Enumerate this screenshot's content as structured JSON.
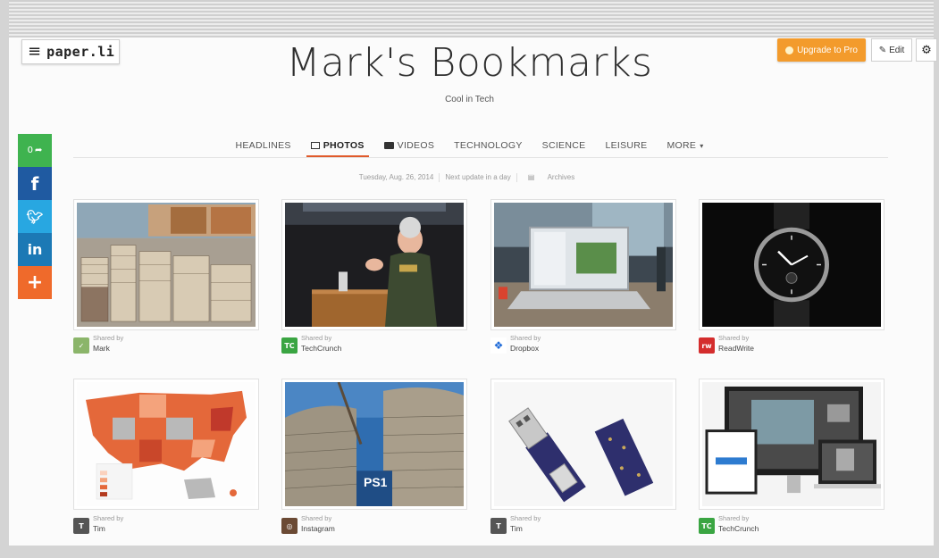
{
  "header": {
    "logo_text": "paper.li",
    "title": "Mark's Bookmarks",
    "subtitle": "Cool in Tech",
    "upgrade_label": "Upgrade to Pro",
    "edit_label": "Edit",
    "colors": {
      "accent": "#e05a2b",
      "upgrade": "#f39b2c"
    }
  },
  "social": {
    "share_count": "0",
    "icons": [
      "share-icon",
      "facebook-icon",
      "twitter-icon",
      "linkedin-icon",
      "plus-icon"
    ]
  },
  "nav": {
    "items": [
      {
        "label": "HEADLINES",
        "active": false
      },
      {
        "label": "PHOTOS",
        "active": true,
        "icon": "photo-icon"
      },
      {
        "label": "VIDEOS",
        "active": false,
        "icon": "video-icon"
      },
      {
        "label": "TECHNOLOGY",
        "active": false
      },
      {
        "label": "SCIENCE",
        "active": false
      },
      {
        "label": "LEISURE",
        "active": false
      },
      {
        "label": "MORE",
        "active": false,
        "icon": "caret-down-icon"
      }
    ]
  },
  "dateline": {
    "date": "Tuesday, Aug. 26, 2014",
    "next_update": "Next update in a day",
    "archives": "Archives"
  },
  "cards": [
    {
      "shared_by_label": "Shared by",
      "source": "Mark",
      "image": "stacks of books photo",
      "avatar": "mark-avatar-icon"
    },
    {
      "shared_by_label": "Shared by",
      "source": "TechCrunch",
      "image": "general at podium photo",
      "avatar": "techcrunch-icon"
    },
    {
      "shared_by_label": "Shared by",
      "source": "Dropbox",
      "image": "laptop on desk photo",
      "avatar": "dropbox-icon"
    },
    {
      "shared_by_label": "Shared by",
      "source": "ReadWrite",
      "image": "smartwatch photo",
      "avatar": "readwrite-icon"
    },
    {
      "shared_by_label": "Shared by",
      "source": "Tim",
      "image": "us map photo",
      "avatar": "tim-avatar-icon"
    },
    {
      "shared_by_label": "Shared by",
      "source": "Instagram",
      "image": "brick sculpture photo",
      "avatar": "instagram-icon"
    },
    {
      "shared_by_label": "Shared by",
      "source": "Tim",
      "image": "usb device photo",
      "avatar": "tim-avatar-icon"
    },
    {
      "shared_by_label": "Shared by",
      "source": "TechCrunch",
      "image": "devices screens photo",
      "avatar": "techcrunch-icon"
    }
  ]
}
